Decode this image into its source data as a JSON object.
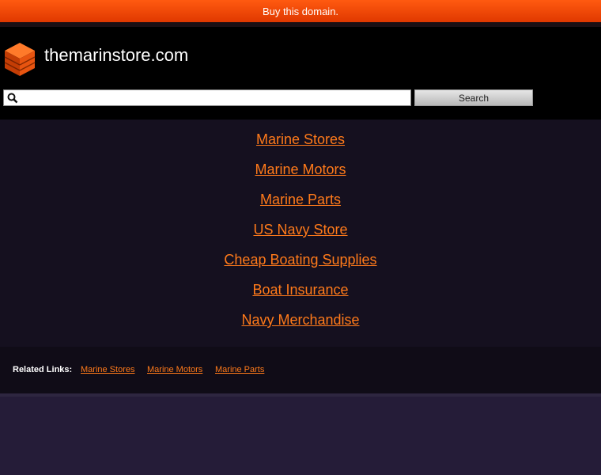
{
  "topbar": {
    "buy_label": "Buy this domain."
  },
  "header": {
    "logo_icon": "orange-stack-cube-icon",
    "site_name": "themarinstore.com"
  },
  "search": {
    "value": "",
    "placeholder": "",
    "button_label": "Search"
  },
  "main": {
    "links": [
      "Marine Stores",
      "Marine Motors",
      "Marine Parts",
      "US Navy Store",
      "Cheap Boating Supplies",
      "Boat Insurance",
      "Navy Merchandise"
    ]
  },
  "related": {
    "label": "Related Links:",
    "links": [
      "Marine Stores",
      "Marine Motors",
      "Marine Parts"
    ]
  },
  "colors": {
    "accent": "#ff7a1a",
    "topbar": "#ff5a10",
    "header_bg": "#000000",
    "main_bg": "#15101f"
  }
}
